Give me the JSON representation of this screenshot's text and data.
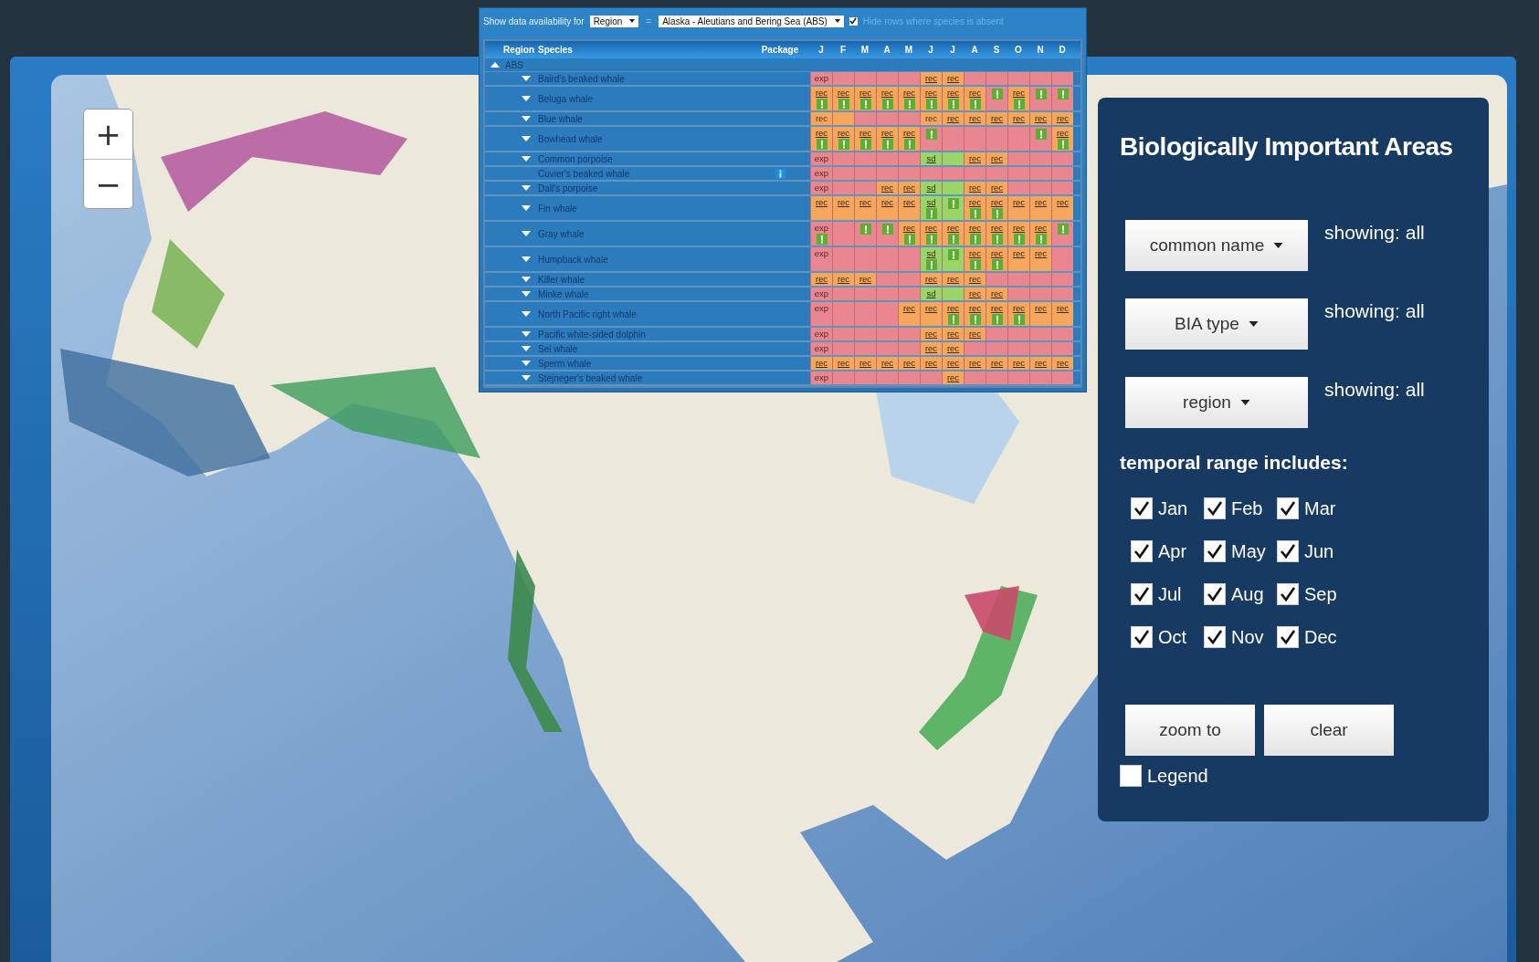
{
  "availability_bar": {
    "label": "Show data availability for",
    "filter_field": "Region",
    "equals": "=",
    "region_field": "Alaska - Aleutians and Bering Sea (ABS)",
    "hide_absent": {
      "label": "Hide rows where species is absent",
      "checked": true
    }
  },
  "table": {
    "columns": [
      "Region",
      "Species",
      "Package"
    ],
    "months": [
      "J",
      "F",
      "M",
      "A",
      "M",
      "J",
      "J",
      "A",
      "S",
      "O",
      "N",
      "D"
    ],
    "group": {
      "name": "ABS",
      "expanded": true,
      "rows": [
        {
          "species": "Baird's beaked whale",
          "expandable": true,
          "package_info": false,
          "cells": [
            {
              "color": "#e9868f",
              "text": "exp",
              "link": false,
              "alert": false
            },
            {
              "color": "#e9868f",
              "alert": false
            },
            {
              "color": "#e9868f",
              "alert": false
            },
            {
              "color": "#e9868f",
              "alert": false
            },
            {
              "color": "#e9868f",
              "alert": false
            },
            {
              "color": "#f6a75c",
              "text": "rec",
              "link": true,
              "alert": false
            },
            {
              "color": "#f6a75c",
              "text": "rec",
              "link": true,
              "alert": false
            },
            {
              "color": "#e9868f",
              "alert": false
            },
            {
              "color": "#e9868f",
              "alert": false
            },
            {
              "color": "#e9868f",
              "alert": false
            },
            {
              "color": "#e9868f",
              "alert": false
            },
            {
              "color": "#e9868f",
              "alert": false
            }
          ]
        },
        {
          "species": "Beluga whale",
          "expandable": true,
          "package_info": false,
          "cells": [
            {
              "color": "#f6a75c",
              "text": "rec",
              "link": true,
              "alert": true
            },
            {
              "color": "#f6a75c",
              "text": "rec",
              "link": true,
              "alert": true
            },
            {
              "color": "#f6a75c",
              "text": "rec",
              "link": true,
              "alert": true
            },
            {
              "color": "#f6a75c",
              "text": "rec",
              "link": true,
              "alert": true
            },
            {
              "color": "#f6a75c",
              "text": "rec",
              "link": true,
              "alert": true
            },
            {
              "color": "#f6a75c",
              "text": "rec",
              "link": true,
              "alert": true
            },
            {
              "color": "#f6a75c",
              "text": "rec",
              "link": true,
              "alert": true
            },
            {
              "color": "#f6a75c",
              "text": "rec",
              "link": true,
              "alert": true
            },
            {
              "color": "#e9868f",
              "alert": true
            },
            {
              "color": "#f6a75c",
              "text": "rec",
              "link": true,
              "alert": true
            },
            {
              "color": "#e9868f",
              "alert": true
            },
            {
              "color": "#e9868f",
              "alert": true
            }
          ]
        },
        {
          "species": "Blue whale",
          "expandable": true,
          "package_info": false,
          "cells": [
            {
              "color": "#f6a75c",
              "text": "rec",
              "link": false,
              "alert": false
            },
            {
              "color": "#f6a75c",
              "alert": false
            },
            {
              "color": "#e9868f",
              "alert": false
            },
            {
              "color": "#e9868f",
              "alert": false
            },
            {
              "color": "#e9868f",
              "alert": false
            },
            {
              "color": "#f6a75c",
              "text": "rec",
              "link": false,
              "alert": false
            },
            {
              "color": "#f6a75c",
              "text": "rec",
              "link": true,
              "alert": false
            },
            {
              "color": "#f6a75c",
              "text": "rec",
              "link": true,
              "alert": false
            },
            {
              "color": "#f6a75c",
              "text": "rec",
              "link": true,
              "alert": false
            },
            {
              "color": "#f6a75c",
              "text": "rec",
              "link": true,
              "alert": false
            },
            {
              "color": "#f6a75c",
              "text": "rec",
              "link": true,
              "alert": false
            },
            {
              "color": "#f6a75c",
              "text": "rec",
              "link": true,
              "alert": false
            }
          ]
        },
        {
          "species": "Bowhead whale",
          "expandable": true,
          "package_info": false,
          "cells": [
            {
              "color": "#f6a75c",
              "text": "rec",
              "link": true,
              "alert": true
            },
            {
              "color": "#f6a75c",
              "text": "rec",
              "link": true,
              "alert": true
            },
            {
              "color": "#f6a75c",
              "text": "rec",
              "link": true,
              "alert": true
            },
            {
              "color": "#f6a75c",
              "text": "rec",
              "link": true,
              "alert": true
            },
            {
              "color": "#f6a75c",
              "text": "rec",
              "link": true,
              "alert": true
            },
            {
              "color": "#e9868f",
              "alert": true
            },
            {
              "color": "#e9868f",
              "alert": false
            },
            {
              "color": "#e9868f",
              "alert": false
            },
            {
              "color": "#e9868f",
              "alert": false
            },
            {
              "color": "#e9868f",
              "alert": false
            },
            {
              "color": "#e9868f",
              "alert": true
            },
            {
              "color": "#f6a75c",
              "text": "rec",
              "link": true,
              "alert": true
            }
          ]
        },
        {
          "species": "Common porpoise",
          "expandable": true,
          "package_info": false,
          "cells": [
            {
              "color": "#e9868f",
              "text": "exp",
              "link": false,
              "alert": false
            },
            {
              "color": "#e9868f",
              "alert": false
            },
            {
              "color": "#e9868f",
              "alert": false
            },
            {
              "color": "#e9868f",
              "alert": false
            },
            {
              "color": "#e9868f",
              "alert": false
            },
            {
              "color": "#9ad56a",
              "text": "sd",
              "link": true,
              "alert": false
            },
            {
              "color": "#9ad56a",
              "alert": false
            },
            {
              "color": "#f6a75c",
              "text": "rec",
              "link": true,
              "alert": false
            },
            {
              "color": "#f6a75c",
              "text": "rec",
              "link": true,
              "alert": false
            },
            {
              "color": "#e9868f",
              "alert": false
            },
            {
              "color": "#e9868f",
              "alert": false
            },
            {
              "color": "#e9868f",
              "alert": false
            }
          ]
        },
        {
          "species": "Cuvier's beaked whale",
          "expandable": false,
          "package_info": true,
          "cells": [
            {
              "color": "#e9868f",
              "text": "exp",
              "link": false,
              "alert": false
            },
            {
              "color": "#e9868f",
              "alert": false
            },
            {
              "color": "#e9868f",
              "alert": false
            },
            {
              "color": "#e9868f",
              "alert": false
            },
            {
              "color": "#e9868f",
              "alert": false
            },
            {
              "color": "#e9868f",
              "alert": false
            },
            {
              "color": "#e9868f",
              "alert": false
            },
            {
              "color": "#e9868f",
              "alert": false
            },
            {
              "color": "#e9868f",
              "alert": false
            },
            {
              "color": "#e9868f",
              "alert": false
            },
            {
              "color": "#e9868f",
              "alert": false
            },
            {
              "color": "#e9868f",
              "alert": false
            }
          ]
        },
        {
          "species": "Dall's porpoise",
          "expandable": true,
          "package_info": false,
          "cells": [
            {
              "color": "#e9868f",
              "text": "exp",
              "link": false,
              "alert": false
            },
            {
              "color": "#e9868f",
              "alert": false
            },
            {
              "color": "#e9868f",
              "alert": false
            },
            {
              "color": "#f6a75c",
              "text": "rec",
              "link": true,
              "alert": false
            },
            {
              "color": "#f6a75c",
              "text": "rec",
              "link": true,
              "alert": false
            },
            {
              "color": "#9ad56a",
              "text": "sd",
              "link": true,
              "alert": false
            },
            {
              "color": "#9ad56a",
              "alert": false
            },
            {
              "color": "#f6a75c",
              "text": "rec",
              "link": true,
              "alert": false
            },
            {
              "color": "#f6a75c",
              "text": "rec",
              "link": true,
              "alert": false
            },
            {
              "color": "#e9868f",
              "alert": false
            },
            {
              "color": "#e9868f",
              "alert": false
            },
            {
              "color": "#e9868f",
              "alert": false
            }
          ]
        },
        {
          "species": "Fin whale",
          "expandable": true,
          "package_info": false,
          "cells": [
            {
              "color": "#f6a75c",
              "text": "rec",
              "link": true,
              "alert": false
            },
            {
              "color": "#f6a75c",
              "text": "rec",
              "link": true,
              "alert": false
            },
            {
              "color": "#f6a75c",
              "text": "rec",
              "link": true,
              "alert": false
            },
            {
              "color": "#f6a75c",
              "text": "rec",
              "link": true,
              "alert": false
            },
            {
              "color": "#f6a75c",
              "text": "rec",
              "link": true,
              "alert": false
            },
            {
              "color": "#9ad56a",
              "text": "sd",
              "link": true,
              "alert": true
            },
            {
              "color": "#9ad56a",
              "alert": true
            },
            {
              "color": "#f6a75c",
              "text": "rec",
              "link": true,
              "alert": true
            },
            {
              "color": "#f6a75c",
              "text": "rec",
              "link": true,
              "alert": true
            },
            {
              "color": "#f6a75c",
              "text": "rec",
              "link": true,
              "alert": false
            },
            {
              "color": "#f6a75c",
              "text": "rec",
              "link": true,
              "alert": false
            },
            {
              "color": "#f6a75c",
              "text": "rec",
              "link": true,
              "alert": false
            }
          ]
        },
        {
          "species": "Gray whale",
          "expandable": true,
          "package_info": false,
          "cells": [
            {
              "color": "#e9868f",
              "text": "exp",
              "link": false,
              "alert": true
            },
            {
              "color": "#e9868f",
              "alert": false
            },
            {
              "color": "#e9868f",
              "alert": true
            },
            {
              "color": "#e9868f",
              "alert": true
            },
            {
              "color": "#f6a75c",
              "text": "rec",
              "link": true,
              "alert": true
            },
            {
              "color": "#f6a75c",
              "text": "rec",
              "link": true,
              "alert": true
            },
            {
              "color": "#f6a75c",
              "text": "rec",
              "link": true,
              "alert": true
            },
            {
              "color": "#f6a75c",
              "text": "rec",
              "link": true,
              "alert": true
            },
            {
              "color": "#f6a75c",
              "text": "rec",
              "link": true,
              "alert": true
            },
            {
              "color": "#f6a75c",
              "text": "rec",
              "link": true,
              "alert": true
            },
            {
              "color": "#f6a75c",
              "text": "rec",
              "link": true,
              "alert": true
            },
            {
              "color": "#e9868f",
              "alert": true
            }
          ]
        },
        {
          "species": "Humpback whale",
          "expandable": true,
          "package_info": false,
          "cells": [
            {
              "color": "#e9868f",
              "text": "exp",
              "link": false,
              "alert": false
            },
            {
              "color": "#e9868f",
              "alert": false
            },
            {
              "color": "#e9868f",
              "alert": false
            },
            {
              "color": "#e9868f",
              "alert": false
            },
            {
              "color": "#e9868f",
              "alert": false
            },
            {
              "color": "#9ad56a",
              "text": "sd",
              "link": true,
              "alert": true
            },
            {
              "color": "#9ad56a",
              "alert": true
            },
            {
              "color": "#f6a75c",
              "text": "rec",
              "link": true,
              "alert": true
            },
            {
              "color": "#f6a75c",
              "text": "rec",
              "link": true,
              "alert": true
            },
            {
              "color": "#f6a75c",
              "text": "rec",
              "link": true,
              "alert": false
            },
            {
              "color": "#f6a75c",
              "text": "rec",
              "link": true,
              "alert": false
            },
            {
              "color": "#e9868f",
              "alert": false
            }
          ]
        },
        {
          "species": "Killer whale",
          "expandable": true,
          "package_info": false,
          "cells": [
            {
              "color": "#f6a75c",
              "text": "rec",
              "link": true,
              "alert": false
            },
            {
              "color": "#f6a75c",
              "text": "rec",
              "link": true,
              "alert": false
            },
            {
              "color": "#f6a75c",
              "text": "rec",
              "link": true,
              "alert": false
            },
            {
              "color": "#e9868f",
              "alert": false
            },
            {
              "color": "#e9868f",
              "alert": false
            },
            {
              "color": "#f6a75c",
              "text": "rec",
              "link": true,
              "alert": false
            },
            {
              "color": "#f6a75c",
              "text": "rec",
              "link": true,
              "alert": false
            },
            {
              "color": "#f6a75c",
              "text": "rec",
              "link": true,
              "alert": false
            },
            {
              "color": "#e9868f",
              "alert": false
            },
            {
              "color": "#e9868f",
              "alert": false
            },
            {
              "color": "#e9868f",
              "alert": false
            },
            {
              "color": "#e9868f",
              "alert": false
            }
          ]
        },
        {
          "species": "Minke whale",
          "expandable": true,
          "package_info": false,
          "cells": [
            {
              "color": "#e9868f",
              "text": "exp",
              "link": false,
              "alert": false
            },
            {
              "color": "#e9868f",
              "alert": false
            },
            {
              "color": "#e9868f",
              "alert": false
            },
            {
              "color": "#e9868f",
              "alert": false
            },
            {
              "color": "#e9868f",
              "alert": false
            },
            {
              "color": "#9ad56a",
              "text": "sd",
              "link": true,
              "alert": false
            },
            {
              "color": "#9ad56a",
              "alert": false
            },
            {
              "color": "#f6a75c",
              "text": "rec",
              "link": true,
              "alert": false
            },
            {
              "color": "#f6a75c",
              "text": "rec",
              "link": true,
              "alert": false
            },
            {
              "color": "#e9868f",
              "alert": false
            },
            {
              "color": "#e9868f",
              "alert": false
            },
            {
              "color": "#e9868f",
              "alert": false
            }
          ]
        },
        {
          "species": "North Pacific right whale",
          "expandable": true,
          "package_info": false,
          "cells": [
            {
              "color": "#e9868f",
              "text": "exp",
              "link": false,
              "alert": false
            },
            {
              "color": "#e9868f",
              "alert": false
            },
            {
              "color": "#e9868f",
              "alert": false
            },
            {
              "color": "#e9868f",
              "alert": false
            },
            {
              "color": "#f6a75c",
              "text": "rec",
              "link": true,
              "alert": false
            },
            {
              "color": "#f6a75c",
              "text": "rec",
              "link": true,
              "alert": false
            },
            {
              "color": "#f6a75c",
              "text": "rec",
              "link": true,
              "alert": true
            },
            {
              "color": "#f6a75c",
              "text": "rec",
              "link": true,
              "alert": true
            },
            {
              "color": "#f6a75c",
              "text": "rec",
              "link": true,
              "alert": true
            },
            {
              "color": "#f6a75c",
              "text": "rec",
              "link": true,
              "alert": true
            },
            {
              "color": "#f6a75c",
              "text": "rec",
              "link": true,
              "alert": false
            },
            {
              "color": "#f6a75c",
              "text": "rec",
              "link": true,
              "alert": false
            }
          ]
        },
        {
          "species": "Pacific white-sided dolphin",
          "expandable": true,
          "package_info": false,
          "cells": [
            {
              "color": "#e9868f",
              "text": "exp",
              "link": false,
              "alert": false
            },
            {
              "color": "#e9868f",
              "alert": false
            },
            {
              "color": "#e9868f",
              "alert": false
            },
            {
              "color": "#e9868f",
              "alert": false
            },
            {
              "color": "#e9868f",
              "alert": false
            },
            {
              "color": "#f6a75c",
              "text": "rec",
              "link": true,
              "alert": false
            },
            {
              "color": "#f6a75c",
              "text": "rec",
              "link": true,
              "alert": false
            },
            {
              "color": "#f6a75c",
              "text": "rec",
              "link": true,
              "alert": false
            },
            {
              "color": "#e9868f",
              "alert": false
            },
            {
              "color": "#e9868f",
              "alert": false
            },
            {
              "color": "#e9868f",
              "alert": false
            },
            {
              "color": "#e9868f",
              "alert": false
            }
          ]
        },
        {
          "species": "Sei whale",
          "expandable": true,
          "package_info": false,
          "cells": [
            {
              "color": "#e9868f",
              "text": "exp",
              "link": false,
              "alert": false
            },
            {
              "color": "#e9868f",
              "alert": false
            },
            {
              "color": "#e9868f",
              "alert": false
            },
            {
              "color": "#e9868f",
              "alert": false
            },
            {
              "color": "#e9868f",
              "alert": false
            },
            {
              "color": "#f6a75c",
              "text": "rec",
              "link": true,
              "alert": false
            },
            {
              "color": "#f6a75c",
              "text": "rec",
              "link": true,
              "alert": false
            },
            {
              "color": "#e9868f",
              "alert": false
            },
            {
              "color": "#e9868f",
              "alert": false
            },
            {
              "color": "#e9868f",
              "alert": false
            },
            {
              "color": "#e9868f",
              "alert": false
            },
            {
              "color": "#e9868f",
              "alert": false
            }
          ]
        },
        {
          "species": "Sperm whale",
          "expandable": true,
          "package_info": false,
          "cells": [
            {
              "color": "#f6a75c",
              "text": "rec",
              "link": true,
              "alert": false
            },
            {
              "color": "#f6a75c",
              "text": "rec",
              "link": true,
              "alert": false
            },
            {
              "color": "#f6a75c",
              "text": "rec",
              "link": true,
              "alert": false
            },
            {
              "color": "#f6a75c",
              "text": "rec",
              "link": true,
              "alert": false
            },
            {
              "color": "#f6a75c",
              "text": "rec",
              "link": true,
              "alert": false
            },
            {
              "color": "#f6a75c",
              "text": "rec",
              "link": true,
              "alert": false
            },
            {
              "color": "#f6a75c",
              "text": "rec",
              "link": true,
              "alert": false
            },
            {
              "color": "#f6a75c",
              "text": "rec",
              "link": true,
              "alert": false
            },
            {
              "color": "#f6a75c",
              "text": "rec",
              "link": true,
              "alert": false
            },
            {
              "color": "#f6a75c",
              "text": "rec",
              "link": true,
              "alert": false
            },
            {
              "color": "#f6a75c",
              "text": "rec",
              "link": true,
              "alert": false
            },
            {
              "color": "#f6a75c",
              "text": "rec",
              "link": true,
              "alert": false
            }
          ]
        },
        {
          "species": "Stejneger's beaked whale",
          "expandable": true,
          "package_info": false,
          "cells": [
            {
              "color": "#e9868f",
              "text": "exp",
              "link": false,
              "alert": false
            },
            {
              "color": "#e9868f",
              "alert": false
            },
            {
              "color": "#e9868f",
              "alert": false
            },
            {
              "color": "#e9868f",
              "alert": false
            },
            {
              "color": "#e9868f",
              "alert": false
            },
            {
              "color": "#e9868f",
              "alert": false
            },
            {
              "color": "#f6a75c",
              "text": "rec",
              "link": true,
              "alert": false
            },
            {
              "color": "#e9868f",
              "alert": false
            },
            {
              "color": "#e9868f",
              "alert": false
            },
            {
              "color": "#e9868f",
              "alert": false
            },
            {
              "color": "#e9868f",
              "alert": false
            },
            {
              "color": "#e9868f",
              "alert": false
            }
          ]
        }
      ]
    }
  },
  "zoom_controls": [
    "+",
    "−"
  ],
  "filter_panel": {
    "title": "Biologically Important Areas",
    "filters": [
      {
        "label": "common name",
        "status": "showing: all"
      },
      {
        "label": "BIA type",
        "status": "showing: all"
      },
      {
        "label": "region",
        "status": "showing: all"
      }
    ],
    "temporal_label": "temporal range includes:",
    "months": [
      {
        "label": "Jan",
        "checked": true
      },
      {
        "label": "Feb",
        "checked": true
      },
      {
        "label": "Mar",
        "checked": true
      },
      {
        "label": "Apr",
        "checked": true
      },
      {
        "label": "May",
        "checked": true
      },
      {
        "label": "Jun",
        "checked": true
      },
      {
        "label": "Jul",
        "checked": true
      },
      {
        "label": "Aug",
        "checked": true
      },
      {
        "label": "Sep",
        "checked": true
      },
      {
        "label": "Oct",
        "checked": true
      },
      {
        "label": "Nov",
        "checked": true
      },
      {
        "label": "Dec",
        "checked": true
      }
    ],
    "buttons": [
      "zoom to",
      "clear"
    ],
    "legend": {
      "label": "Legend",
      "checked": false
    }
  }
}
